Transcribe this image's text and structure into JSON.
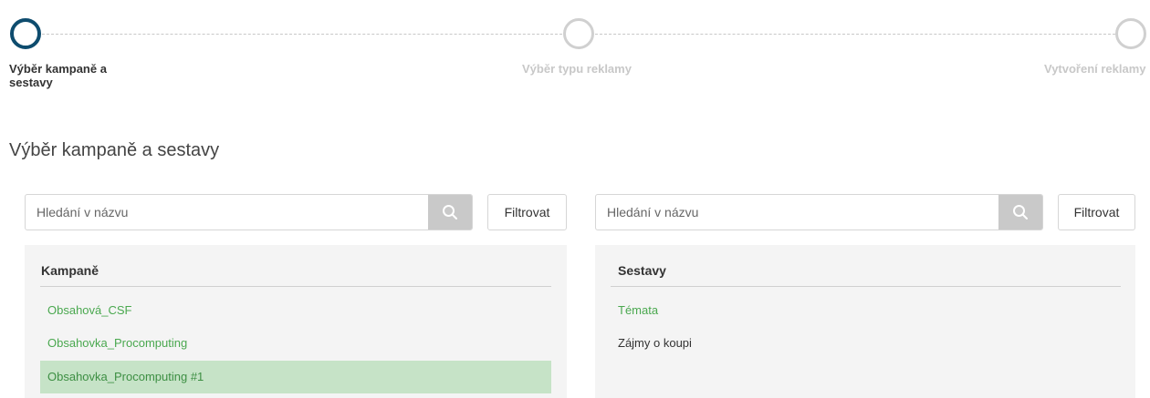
{
  "stepper": {
    "steps": [
      {
        "label": "Výběr kampaně a sestavy",
        "state": "active"
      },
      {
        "label": "Výběr typu reklamy",
        "state": "inactive"
      },
      {
        "label": "Vytvoření reklamy",
        "state": "inactive"
      }
    ]
  },
  "page": {
    "title": "Výběr kampaně a sestavy"
  },
  "campaigns_panel": {
    "search_placeholder": "Hledání v názvu",
    "search_icon": "search-icon",
    "filter_label": "Filtrovat",
    "header": "Kampaně",
    "items": [
      {
        "label": "Obsahová_CSF",
        "selected": false
      },
      {
        "label": "Obsahovka_Procomputing",
        "selected": false
      },
      {
        "label": "Obsahovka_Procomputing #1",
        "selected": true
      }
    ]
  },
  "adsets_panel": {
    "search_placeholder": "Hledání v názvu",
    "search_icon": "search-icon",
    "filter_label": "Filtrovat",
    "header": "Sestavy",
    "items": [
      {
        "label": "Témata",
        "selected": false
      },
      {
        "label": "Zájmy o koupi",
        "selected": false
      }
    ]
  },
  "colors": {
    "active_step": "#0e4c6e",
    "inactive_step": "#d0d0d0",
    "link_green": "#4aa84f",
    "selected_bg": "#c6e3c7",
    "search_button_bg": "#c9c9c9"
  }
}
